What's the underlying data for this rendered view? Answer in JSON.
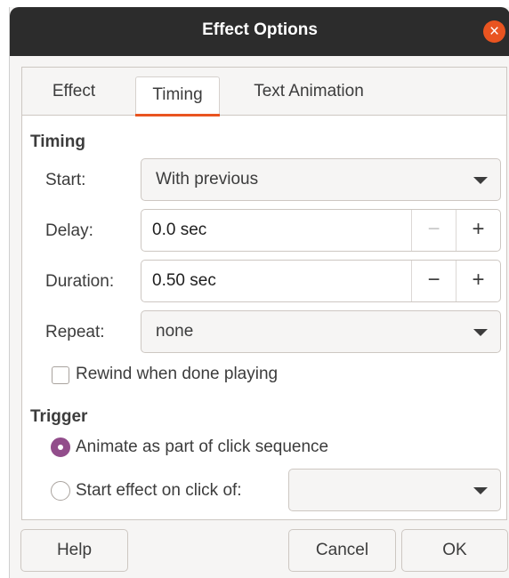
{
  "window": {
    "title": "Effect Options",
    "close_icon": "close-icon",
    "accent": "#e95420"
  },
  "tabs": [
    {
      "label": "Effect",
      "active": false
    },
    {
      "label": "Timing",
      "active": true
    },
    {
      "label": "Text Animation",
      "active": false
    }
  ],
  "timing": {
    "section_title": "Timing",
    "start": {
      "label": "Start:",
      "value": "With previous"
    },
    "delay": {
      "label": "Delay:",
      "value": "0.0 sec",
      "minus": "−",
      "plus": "+"
    },
    "duration": {
      "label": "Duration:",
      "value": "0.50 sec",
      "minus": "−",
      "plus": "+"
    },
    "repeat": {
      "label": "Repeat:",
      "value": "none"
    },
    "rewind": {
      "label": "Rewind when done playing",
      "checked": false
    }
  },
  "trigger": {
    "section_title": "Trigger",
    "option_sequence": {
      "label": "Animate as part of click sequence",
      "checked": true
    },
    "option_click": {
      "label": "Start effect on click of:",
      "checked": false,
      "value": ""
    }
  },
  "buttons": {
    "help": "Help",
    "cancel": "Cancel",
    "ok": "OK"
  },
  "colors": {
    "radio_checked": "#924d8b",
    "tab_underline": "#e95420"
  }
}
